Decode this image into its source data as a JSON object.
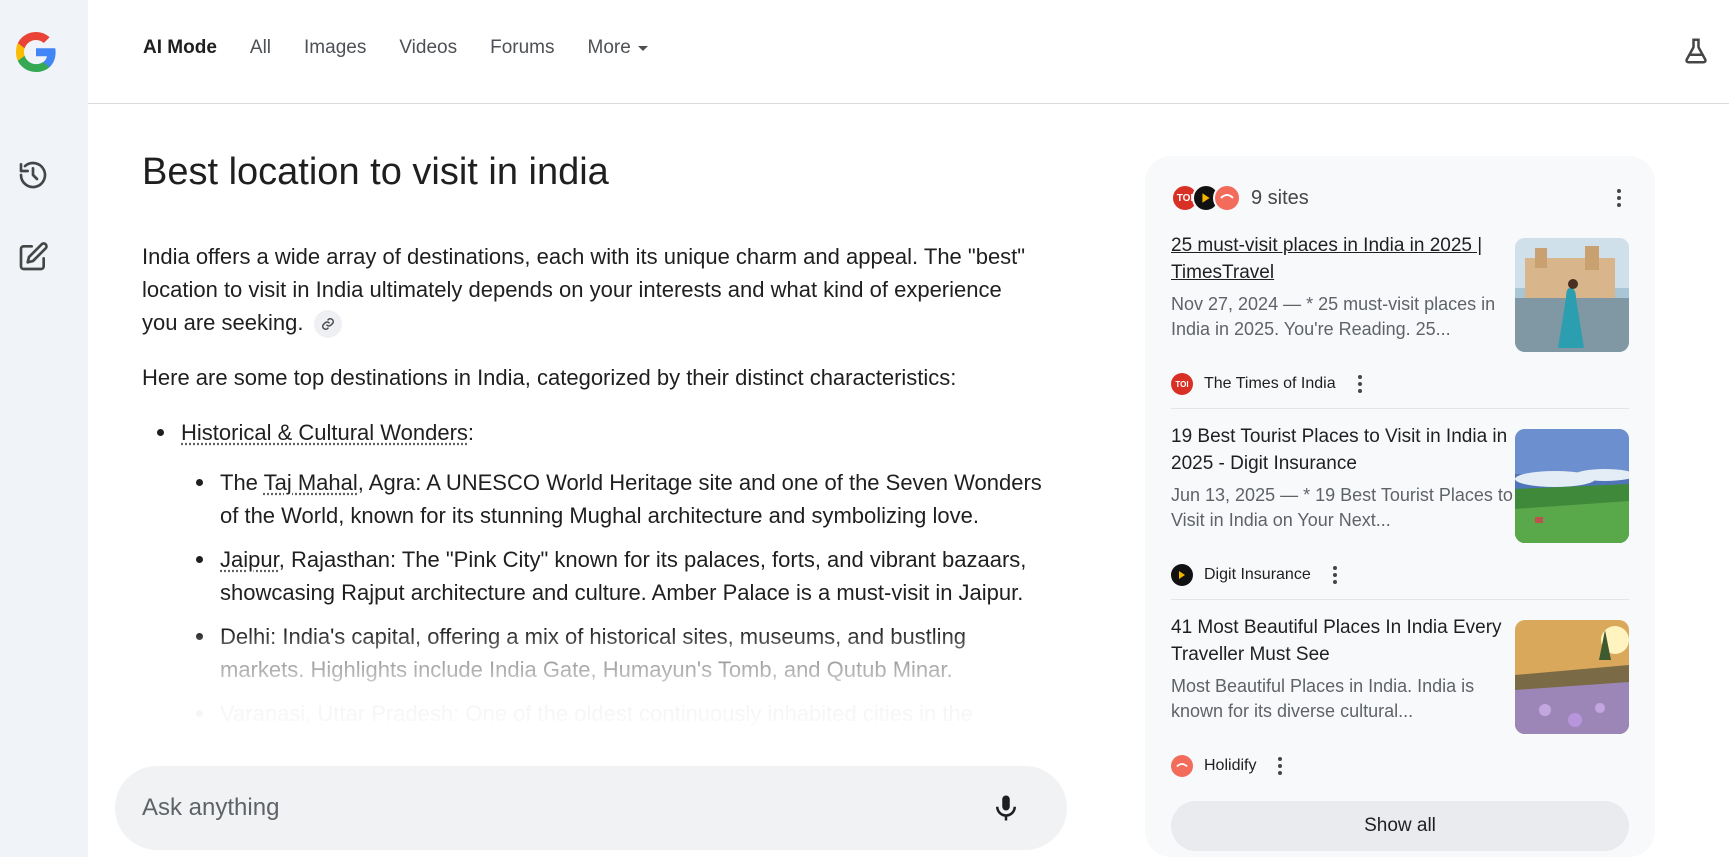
{
  "topnav": {
    "tabs": [
      {
        "label": "AI Mode",
        "active": true
      },
      {
        "label": "All"
      },
      {
        "label": "Images"
      },
      {
        "label": "Videos"
      },
      {
        "label": "Forums"
      },
      {
        "label": "More"
      }
    ]
  },
  "sidebar": {
    "icons": [
      "history-icon",
      "new-chat-icon"
    ]
  },
  "main": {
    "query": "Best location to visit in india",
    "intro": "India offers a wide array of destinations, each with its unique charm and appeal. The \"best\" location to visit in India ultimately depends on your interests and what kind of experience you are seeking.",
    "lead_in": "Here are some top destinations in India, categorized by their distinct characteristics:",
    "category": {
      "label": "Historical & Cultural Wonders",
      "suffix": ":",
      "items": [
        {
          "prefix": "The ",
          "link": "Taj Mahal",
          "text": ", Agra: A UNESCO World Heritage site and one of the Seven Wonders of the World, known for its stunning Mughal architecture and symbolizing love."
        },
        {
          "prefix": "",
          "link": "Jaipur",
          "text": ", Rajasthan: The \"Pink City\" known for its palaces, forts, and vibrant bazaars, showcasing Rajput architecture and culture. Amber Palace is a must-visit in Jaipur."
        },
        {
          "prefix": "",
          "link": "",
          "text": "Delhi: India's capital, offering a mix of historical sites, museums, and bustling markets. Highlights include India Gate, Humayun's Tomb, and Qutub Minar."
        },
        {
          "prefix": "",
          "link": "",
          "text": "Varanasi, Uttar Pradesh: One of the oldest continuously inhabited cities in the"
        }
      ]
    }
  },
  "ask": {
    "placeholder": "Ask anything"
  },
  "sources": {
    "count_label": "9 sites",
    "items": [
      {
        "title": "25 must-visit places in India in 2025 | TimesTravel",
        "snippet": "Nov 27, 2024 — * 25 must-visit places in India in 2025. You're Reading. 25...",
        "site": "The Times of India",
        "favicon_text": "TOI",
        "favicon_color": "#d93025"
      },
      {
        "title": "19 Best Tourist Places to Visit in India in 2025 - Digit Insurance",
        "snippet": "Jun 13, 2025 — * 19 Best Tourist Places to Visit in India on Your Next...",
        "site": "Digit Insurance",
        "favicon_text": "",
        "favicon_color": "#111111"
      },
      {
        "title": "41 Most Beautiful Places In India Every Traveller Must See",
        "snippet": "Most Beautiful Places in India. India is known for its diverse cultural...",
        "site": "Holidify",
        "favicon_text": "",
        "favicon_color": "#f26b5b"
      }
    ],
    "show_all_label": "Show all"
  }
}
